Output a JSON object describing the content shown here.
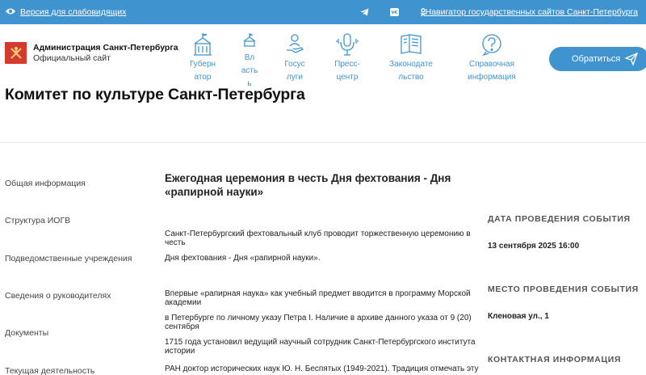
{
  "topbar": {
    "accessibility_label": "Версия для слабовидящих",
    "social_icons": [
      "telegram-icon",
      "vk-icon",
      "odnoklassniki-icon"
    ],
    "navigator_link": "Навигатор государственных сайтов Санкт-Петербурга",
    "bg_color": "#3f94cf"
  },
  "logo": {
    "title": "Администрация Санкт-Петербурга",
    "subtitle": "Официальный сайт",
    "color": "#d43b2e"
  },
  "nav": [
    {
      "lines": [
        "Губерн",
        "атор"
      ],
      "icon": "building-icon"
    },
    {
      "lines": [
        "Вл",
        "асть",
        "ь"
      ],
      "icon": "institution-icon"
    },
    {
      "lines": [
        "Госус",
        "луги"
      ],
      "icon": "user-hand-icon"
    },
    {
      "lines": [
        "Пресс-",
        "центр"
      ],
      "icon": "microphone-icon"
    },
    {
      "lines": [
        "Законодате",
        "льство"
      ],
      "icon": "book-icon"
    },
    {
      "lines": [
        "Справочная",
        "информация"
      ],
      "icon": "question-icon"
    }
  ],
  "cta_label": "Обратиться",
  "page_title": "Комитет по культуре Санкт-Петербурга",
  "sidebar": [
    "Общая информация",
    "Структура ИОГВ",
    "Подведомственные учреждения",
    "Сведения о руководителях",
    "Документы",
    "Текущая деятельность"
  ],
  "article": {
    "title_lines": [
      "Ежегодная церемония в честь Дня фехтования - Дня",
      "«рапирной науки»"
    ],
    "paragraphs": [
      "Санкт-Петербургский фехтовальный клуб проводит торжественную церемонию в честь",
      "Дня фехтования - Дня «рапирной науки».",
      "Впервые «рапирная наука» как учебный предмет вводится в программу Морской академии",
      "в Петербурге по личному указу Петра I. Наличие в архиве данного указа от 9 (20) сентября",
      "1715 года установил ведущий научный сотрудник Санкт-Петербургского института истории",
      "РАН доктор исторических наук Ю. Н. Беспятых (1949-2021). Традиция отмечать эту дату"
    ]
  },
  "details": {
    "date_heading": "ДАТА ПРОВЕДЕНИЯ СОБЫТИЯ",
    "date_value": "13 сентября 2025 16:00",
    "place_heading": "МЕСТО ПРОВЕДЕНИЯ СОБЫТИЯ",
    "place_value": "Кленовая ул., 1",
    "contact_heading": "КОНТАКТНАЯ ИНФОРМАЦИЯ"
  }
}
